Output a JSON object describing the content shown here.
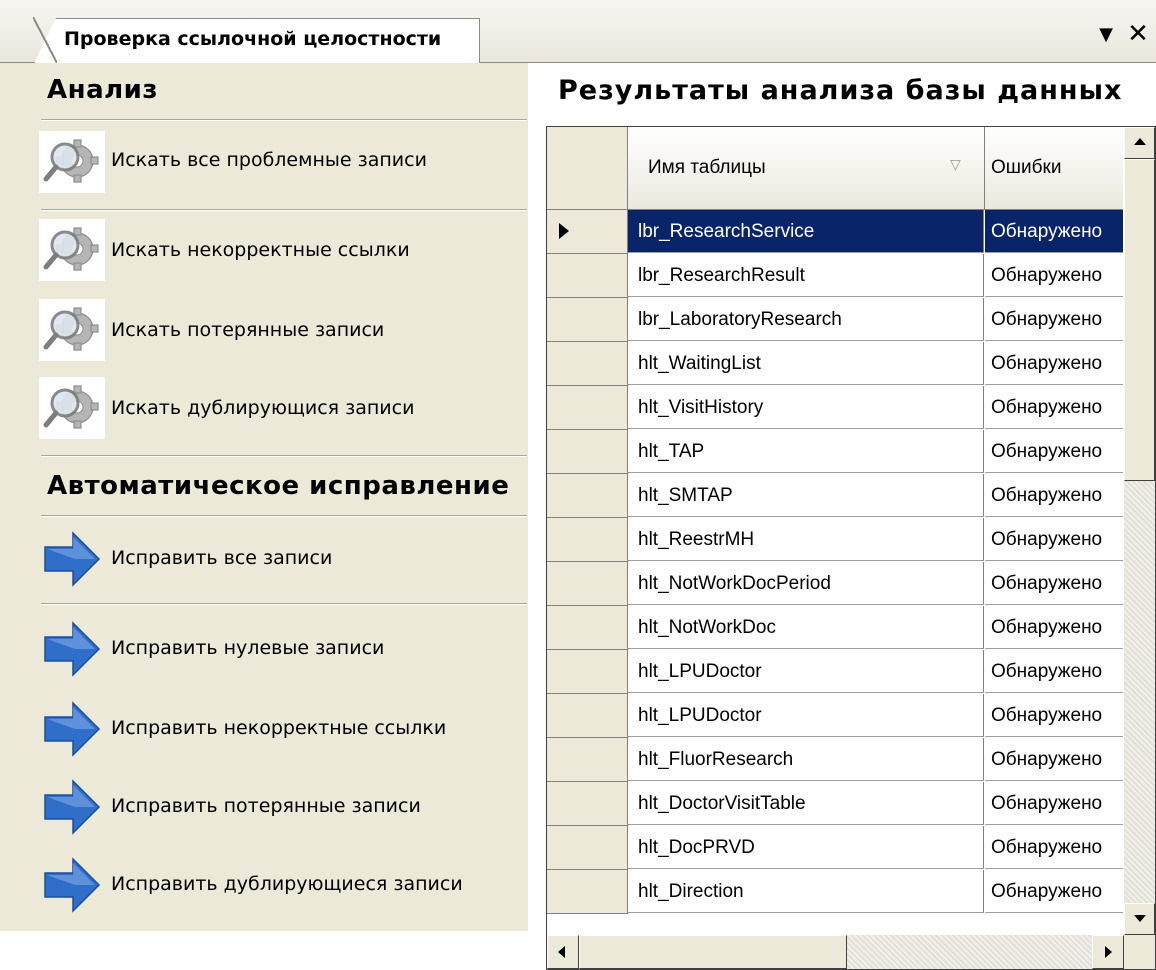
{
  "tab": {
    "title": "Проверка ссылочной целостности",
    "menu_icon": "dropdown-arrow-icon",
    "close_icon": "close-icon"
  },
  "analysis": {
    "title": "Анализ",
    "items": [
      {
        "label": "Искать все проблемные записи",
        "icon": "magnifier-gear-icon"
      },
      {
        "label": "Искать некорректные ссылки",
        "icon": "magnifier-gear-icon"
      },
      {
        "label": "Искать потерянные записи",
        "icon": "magnifier-gear-icon"
      },
      {
        "label": "Искать дублирующися записи",
        "icon": "magnifier-gear-icon"
      }
    ]
  },
  "autofix": {
    "title": "Автоматическое исправление",
    "items": [
      {
        "label": "Исправить все записи",
        "icon": "blue-arrow-icon"
      },
      {
        "label": "Исправить нулевые записи",
        "icon": "blue-arrow-icon"
      },
      {
        "label": "Исправить некорректные ссылки",
        "icon": "blue-arrow-icon"
      },
      {
        "label": "Исправить потерянные записи",
        "icon": "blue-arrow-icon"
      },
      {
        "label": "Исправить дублирующиеся записи",
        "icon": "blue-arrow-icon"
      }
    ]
  },
  "results": {
    "title": "Результаты анализа базы данных",
    "columns": [
      "Имя таблицы",
      "Ошибки"
    ],
    "selected_row": 0,
    "rows": [
      {
        "table": "lbr_ResearchService",
        "errors": "Обнаружено"
      },
      {
        "table": "lbr_ResearchResult",
        "errors": "Обнаружено"
      },
      {
        "table": "lbr_LaboratoryResearch",
        "errors": "Обнаружено"
      },
      {
        "table": "hlt_WaitingList",
        "errors": "Обнаружено"
      },
      {
        "table": "hlt_VisitHistory",
        "errors": "Обнаружено"
      },
      {
        "table": "hlt_TAP",
        "errors": "Обнаружено"
      },
      {
        "table": "hlt_SMTAP",
        "errors": "Обнаружено"
      },
      {
        "table": "hlt_ReestrMH",
        "errors": "Обнаружено"
      },
      {
        "table": "hlt_NotWorkDocPeriod",
        "errors": "Обнаружено"
      },
      {
        "table": "hlt_NotWorkDoc",
        "errors": "Обнаружено"
      },
      {
        "table": "hlt_LPUDoctor",
        "errors": "Обнаружено"
      },
      {
        "table": "hlt_LPUDoctor",
        "errors": "Обнаружено"
      },
      {
        "table": "hlt_FluorResearch",
        "errors": "Обнаружено"
      },
      {
        "table": "hlt_DoctorVisitTable",
        "errors": "Обнаружено"
      },
      {
        "table": "hlt_DocPRVD",
        "errors": "Обнаружено"
      },
      {
        "table": "hlt_Direction",
        "errors": "Обнаружено"
      }
    ]
  },
  "colors": {
    "panel_bg": "#ece9d8",
    "selection": "#0a246a",
    "arrow_blue": "#2f6ec9"
  }
}
